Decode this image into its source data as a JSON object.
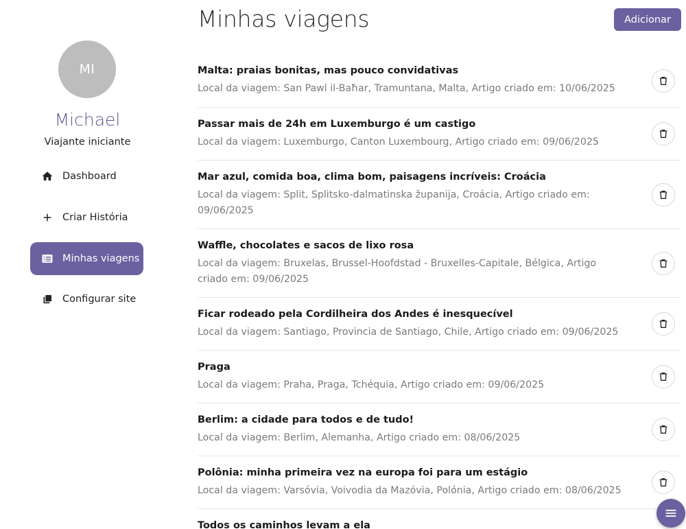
{
  "sidebar": {
    "avatar_initials": "MI",
    "user_name": "Michael",
    "user_role": "Viajante iniciante",
    "items": [
      {
        "label": "Dashboard",
        "icon": "home-icon"
      },
      {
        "label": "Criar História",
        "icon": "plus-icon"
      },
      {
        "label": "Minhas viagens",
        "icon": "list-icon",
        "active": true
      },
      {
        "label": "Configurar site",
        "icon": "copy-icon"
      }
    ]
  },
  "header": {
    "title": "Minhas viagens",
    "add_label": "Adicionar"
  },
  "trips": [
    {
      "title": "Malta: praias bonitas, mas pouco convidativas",
      "sub": "Local da viagem: San Pawl il-Baħar, Tramuntana, Malta, Artigo criado em: 10/06/2025"
    },
    {
      "title": "Passar mais de 24h em Luxemburgo é um castigo",
      "sub": "Local da viagem: Luxemburgo, Canton Luxembourg, Artigo criado em: 09/06/2025"
    },
    {
      "title": "Mar azul, comida boa, clima bom, paisagens incríveis: Croácia",
      "sub": "Local da viagem: Split, Splitsko-dalmatinska županija, Croácia, Artigo criado em: 09/06/2025"
    },
    {
      "title": "Waffle, chocolates e sacos de lixo rosa",
      "sub": "Local da viagem: Bruxelas, Brussel-Hoofdstad - Bruxelles-Capitale, Bélgica, Artigo criado em: 09/06/2025"
    },
    {
      "title": "Ficar rodeado pela Cordilheira dos Andes é inesquecível",
      "sub": "Local da viagem: Santiago, Provincia de Santiago, Chile, Artigo criado em: 09/06/2025"
    },
    {
      "title": "Praga",
      "sub": "Local da viagem: Praha, Praga, Tchéquia, Artigo criado em: 09/06/2025"
    },
    {
      "title": "Berlim: a cidade para todos e de tudo!",
      "sub": "Local da viagem: Berlim, Alemanha, Artigo criado em: 08/06/2025"
    },
    {
      "title": "Polônia: minha primeira vez na europa foi para um estágio",
      "sub": "Local da viagem: Varsóvia, Voivodia da Mazóvia, Polónia, Artigo criado em: 08/06/2025"
    },
    {
      "title": "Todos os caminhos levam a ela",
      "sub": ""
    }
  ],
  "colors": {
    "accent": "#6b61a0",
    "avatar": "#bdbdbd"
  },
  "icons": {
    "delete": "trash-icon",
    "fab": "menu-icon"
  }
}
